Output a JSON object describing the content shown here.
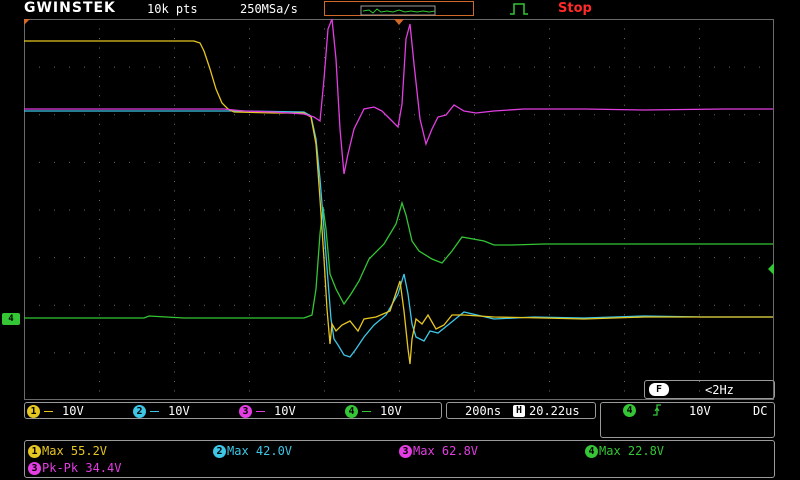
{
  "header": {
    "brand": "GWINSTEK",
    "record_length": "10k pts",
    "sample_rate": "250MSa/s",
    "run_status": "Stop",
    "run_status_color": "#ff2a2a"
  },
  "channels": [
    {
      "num": "1",
      "scale": "10V",
      "color": "#e6c620"
    },
    {
      "num": "2",
      "scale": "10V",
      "color": "#3ec6e6"
    },
    {
      "num": "3",
      "scale": "10V",
      "color": "#e23ee2"
    },
    {
      "num": "4",
      "scale": "10V",
      "color": "#34c634"
    }
  ],
  "ground_marker": "4",
  "timebase": {
    "div": "200ns",
    "h_icon": "H",
    "position": "20.22us"
  },
  "frequency": {
    "icon": "F",
    "value": "<2Hz"
  },
  "trigger": {
    "source": "4",
    "slope": "rising",
    "level": "10V",
    "coupling": "DC"
  },
  "measurements": [
    {
      "ch": "1",
      "text": "Max 55.2V",
      "color": "#e6c620"
    },
    {
      "ch": "2",
      "text": "Max 42.0V",
      "color": "#3ec6e6"
    },
    {
      "ch": "3",
      "text": "Max 62.8V",
      "color": "#e23ee2"
    },
    {
      "ch": "4",
      "text": "Max 22.8V",
      "color": "#34c634"
    },
    {
      "ch": "3",
      "text": "Pk-Pk 34.4V",
      "color": "#e23ee2"
    }
  ],
  "colors": {
    "grid_dot": "#6a6a6a",
    "frame": "#9a9a9a",
    "memory_bar": "#d06a2a",
    "trigger_icon": "#34c634"
  }
}
